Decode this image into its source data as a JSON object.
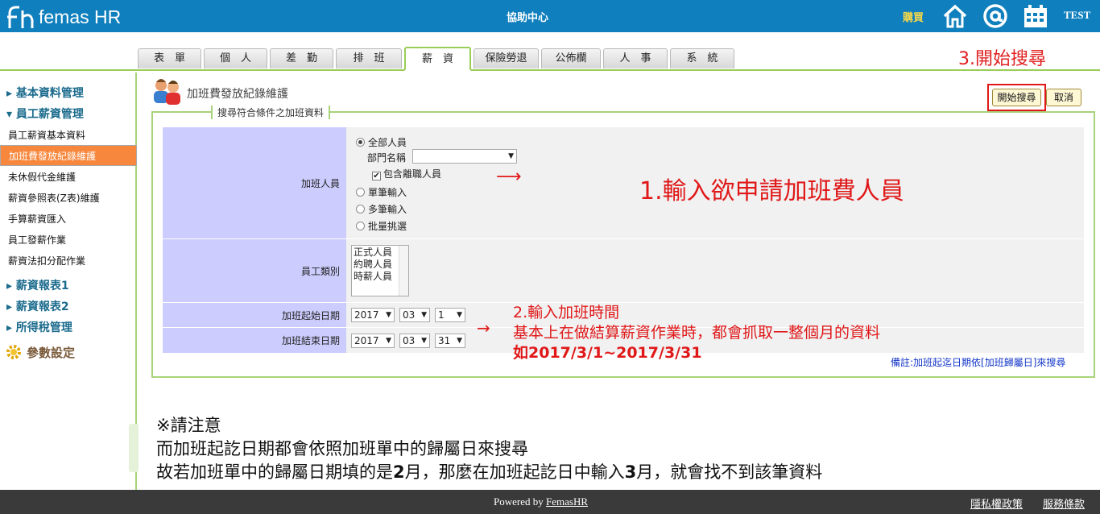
{
  "header": {
    "logo_text": "femas HR",
    "help_center": "協助中心",
    "buy": "購買",
    "username": "TEST"
  },
  "tabs": [
    {
      "label": "表　單"
    },
    {
      "label": "個　人"
    },
    {
      "label": "差　勤"
    },
    {
      "label": "排　班"
    },
    {
      "label": "薪　資"
    },
    {
      "label": "保險勞退"
    },
    {
      "label": "公佈欄"
    },
    {
      "label": "人　事"
    },
    {
      "label": "系　統"
    }
  ],
  "annotations": {
    "step1": "1.輸入欲申請加班費人員",
    "step2_line1": "2.輸入加班時間",
    "step2_line2": "基本上在做結算薪資作業時，都會抓取一整個月的資料",
    "step2_line3": "如2017/3/1~2017/3/31",
    "step3": "3.開始搜尋",
    "arrow1": "⟶",
    "arrow2": "→"
  },
  "sidebar": {
    "groups": [
      {
        "label": "▸ 基本資料管理"
      },
      {
        "label": "▾ 員工薪資管理"
      },
      {
        "label": "▸ 薪資報表1"
      },
      {
        "label": "▸ 薪資報表2"
      },
      {
        "label": "▸ 所得稅管理"
      },
      {
        "label": "參數設定"
      }
    ],
    "items": [
      {
        "label": "員工薪資基本資料"
      },
      {
        "label": "加班費發放紀錄維護"
      },
      {
        "label": "未休假代金維護"
      },
      {
        "label": "薪資參照表(Z表)維護"
      },
      {
        "label": "手算薪資匯入"
      },
      {
        "label": "員工發薪作業"
      },
      {
        "label": "薪資法扣分配作業"
      }
    ]
  },
  "page": {
    "title": "加班費發放紀錄維護",
    "legend": "搜尋符合條件之加班資料",
    "search_button": "開始搜尋",
    "cancel_button": "取消"
  },
  "form": {
    "overtime_staff_label": "加班人員",
    "opt_all": "全部人員",
    "dept_label": "部門名稱",
    "dept_value": "",
    "include_resigned": "包含離職人員",
    "opt_single": "單筆輸入",
    "opt_multi": "多筆輸入",
    "opt_batch": "批量挑選",
    "emp_type_label": "員工類別",
    "emp_types": [
      "正式人員",
      "約聘人員",
      "時薪人員"
    ],
    "start_label": "加班起始日期",
    "start_year": "2017",
    "start_month": "03",
    "start_day": "1",
    "end_label": "加班結束日期",
    "end_year": "2017",
    "end_month": "03",
    "end_day": "31",
    "remark": "備註:加班起迄日期依[加班歸屬日]來搜尋"
  },
  "bottom_note": {
    "line1": "※請注意",
    "line2": "而加班起訖日期都會依照加班單中的歸屬日來搜尋",
    "line3a": "故若加班單中的歸屬日期填的是",
    "line3b": "2",
    "line3c": "月，那麼在加班起訖日中輸入",
    "line3d": "3",
    "line3e": "月，就會找不到該筆資料"
  },
  "footer": {
    "powered": "Powered by ",
    "brand": "FemasHR",
    "privacy": "隱私權政策",
    "terms": "服務條款"
  }
}
